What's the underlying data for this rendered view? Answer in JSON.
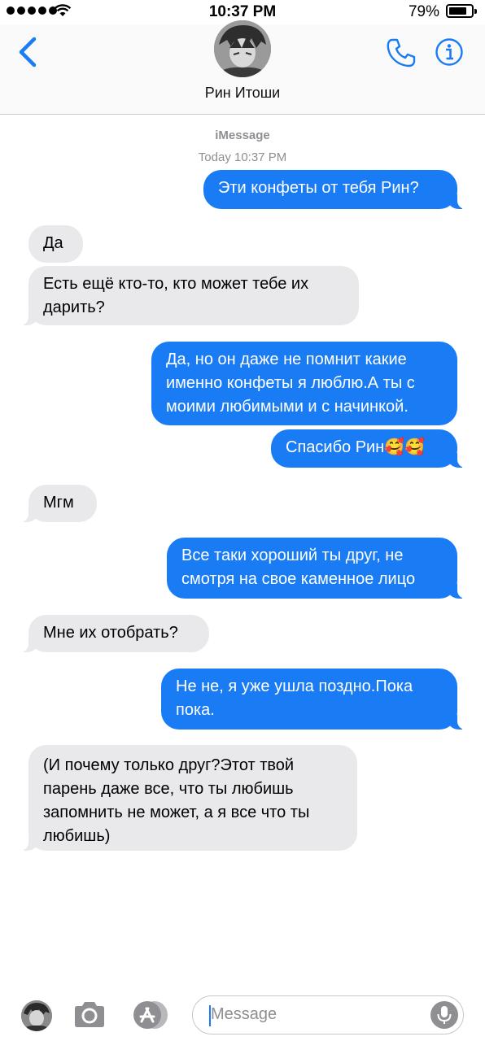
{
  "status_bar": {
    "time": "10:37 PM",
    "battery_percent": "79%",
    "battery_level": 0.79,
    "signal_bars": 5
  },
  "header": {
    "contact_name": "Рин Итоши"
  },
  "conversation": {
    "service": "iMessage",
    "timestamp": "Today 10:37 PM",
    "messages": [
      {
        "from": "me",
        "text": "Эти конфеты от тебя Рин?"
      },
      {
        "from": "them",
        "text": "Да"
      },
      {
        "from": "them",
        "text": "Есть ещё кто-то, кто может тебе их дарить?"
      },
      {
        "from": "me",
        "text": "Да, но он даже не помнит какие именно конфеты я люблю.А ты с моими любимыми и с начинкой."
      },
      {
        "from": "me",
        "text": "Спасибо Рин🥰🥰"
      },
      {
        "from": "them",
        "text": "Мгм"
      },
      {
        "from": "me",
        "text": "Все таки хороший ты друг, не смотря на свое каменное лицо"
      },
      {
        "from": "them",
        "text": "Мне их отобрать?"
      },
      {
        "from": "me",
        "text": "Не не, я уже ушла поздно.Пока пока."
      },
      {
        "from": "them",
        "text": "(И почему только друг?Этот твой парень даже все, что ты любишь запомнить не может, а я все что ты любишь)"
      }
    ]
  },
  "compose": {
    "placeholder": "Message"
  },
  "colors": {
    "sent_bubble": "#1a7cf5",
    "received_bubble": "#e9e9eb",
    "accent": "#1a7cf5",
    "meta_text": "#8e8e93"
  },
  "icons": [
    "back-chevron-icon",
    "phone-icon",
    "info-icon",
    "camera-icon",
    "app-store-icon",
    "microphone-icon"
  ]
}
